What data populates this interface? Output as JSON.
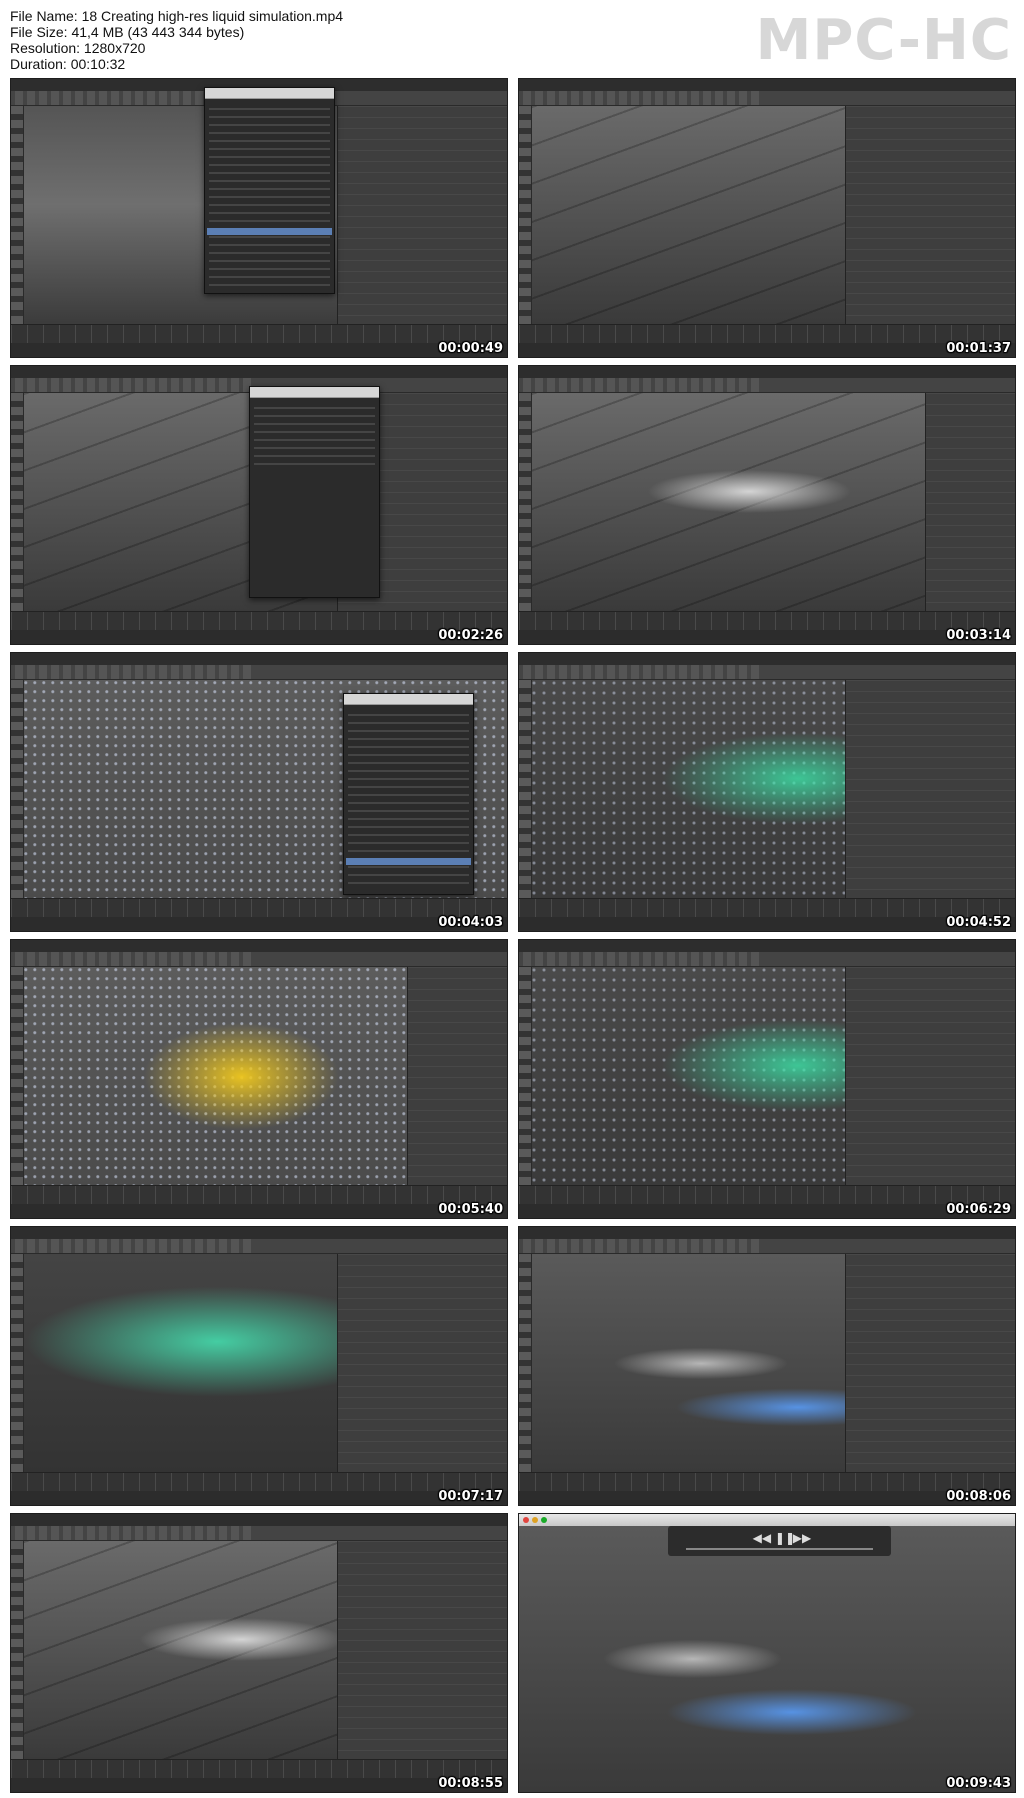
{
  "file_info": {
    "file_name": "File Name: 18 Creating high-res liquid simulation.mp4",
    "file_size": "File Size: 41,4 MB (43 443 344 bytes)",
    "resolution": "Resolution: 1280x720",
    "duration": "Duration: 00:10:32"
  },
  "logo": "MPC-HC",
  "thumbnails": [
    {
      "timestamp": "00:00:49",
      "scene": "outliner-over-viewport"
    },
    {
      "timestamp": "00:01:37",
      "scene": "empty-floor"
    },
    {
      "timestamp": "00:02:26",
      "scene": "spider-outliner"
    },
    {
      "timestamp": "00:03:14",
      "scene": "emitter-white-particles"
    },
    {
      "timestamp": "00:04:03",
      "scene": "particles-outliner"
    },
    {
      "timestamp": "00:04:52",
      "scene": "green-spider-attributes"
    },
    {
      "timestamp": "00:05:40",
      "scene": "yellow-spider"
    },
    {
      "timestamp": "00:06:29",
      "scene": "emitter-green-particles"
    },
    {
      "timestamp": "00:07:17",
      "scene": "teal-particles"
    },
    {
      "timestamp": "00:08:06",
      "scene": "emitter-blue-liquid"
    },
    {
      "timestamp": "00:08:55",
      "scene": "emitter-white-attributes"
    },
    {
      "timestamp": "00:09:43",
      "scene": "player-playback"
    }
  ]
}
